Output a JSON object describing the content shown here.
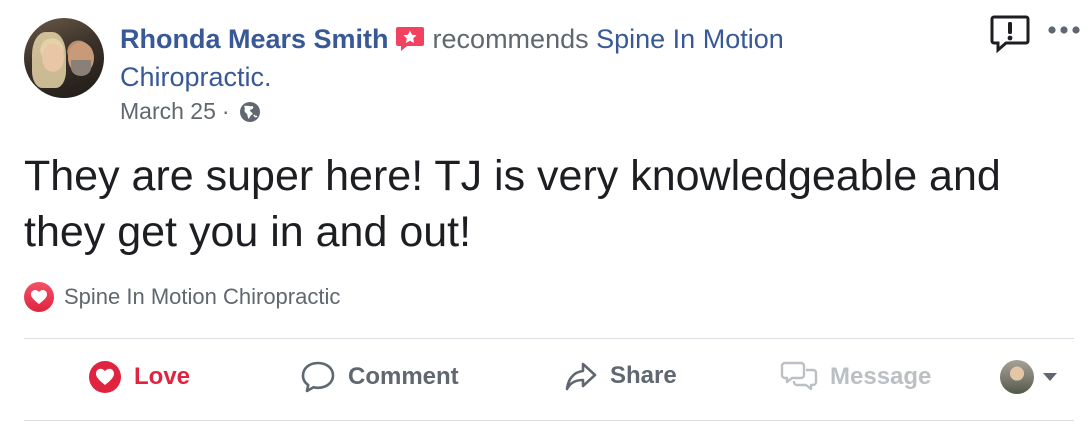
{
  "post": {
    "author": "Rhonda Mears Smith",
    "verb": "recommends",
    "page_line1": "Spine In Motion",
    "page_line2": "Chiropractic.",
    "date": "March 25",
    "separator": "·",
    "body_line1": "They are super here! TJ is very knowledgeable and",
    "body_line2": "they get you in and out!"
  },
  "reaction": {
    "label": "Spine In Motion Chiropractic"
  },
  "actions": {
    "love": "Love",
    "comment": "Comment",
    "share": "Share",
    "message": "Message"
  },
  "icons": {
    "recommend": "recommend-star-icon",
    "globe": "globe-icon",
    "report": "report-icon",
    "more": "more-icon",
    "heart": "heart-icon",
    "comment": "comment-icon",
    "share": "share-icon",
    "message": "message-icon",
    "caret": "caret-down-icon"
  },
  "colors": {
    "link": "#385898",
    "secondary_text": "#606770",
    "love": "#e0243f",
    "recommend_badge": "#f3425f",
    "disabled": "#bcc0c4"
  }
}
